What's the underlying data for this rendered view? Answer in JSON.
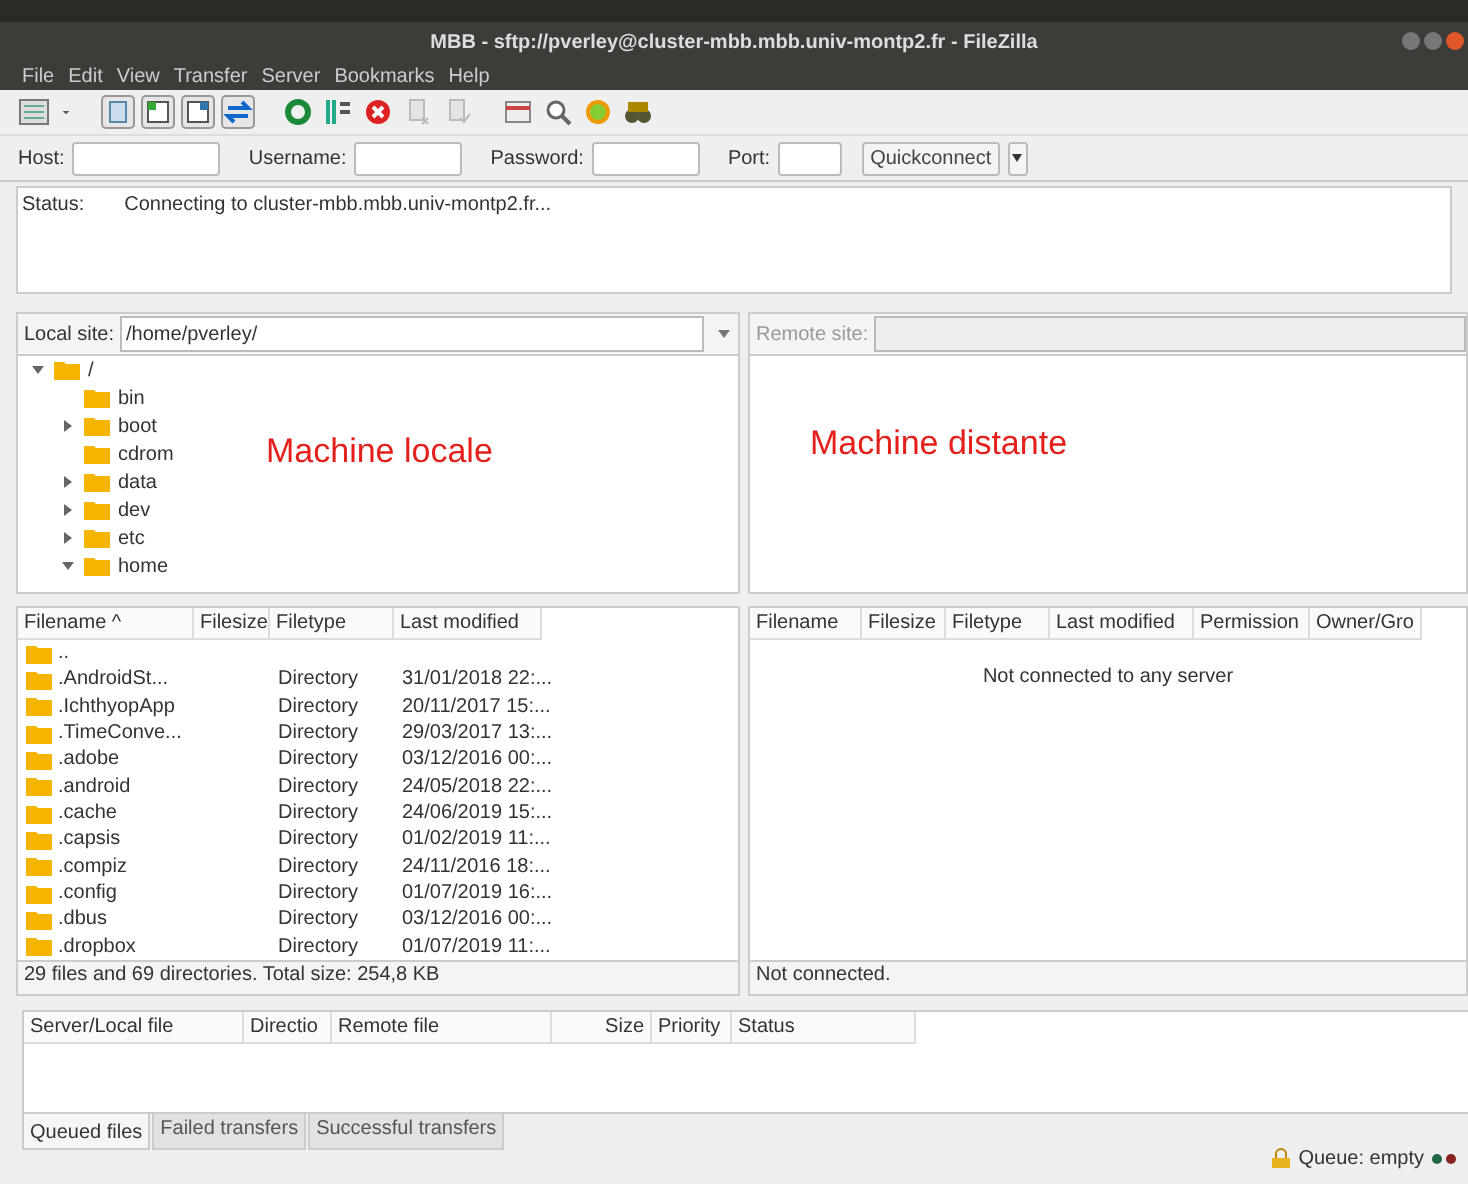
{
  "window": {
    "title": "MBB - sftp://pverley@cluster-mbb.mbb.univ-montp2.fr - FileZilla"
  },
  "menu": [
    "File",
    "Edit",
    "View",
    "Transfer",
    "Server",
    "Bookmarks",
    "Help"
  ],
  "quickconnect": {
    "fields": [
      {
        "label": "Host:"
      },
      {
        "label": "Username:"
      },
      {
        "label": "Password:"
      },
      {
        "label": "Port:"
      }
    ],
    "button": "Quickconnect"
  },
  "log": [
    {
      "label": "Status:",
      "text": "Connecting to cluster-mbb.mbb.univ-montp2.fr..."
    }
  ],
  "local": {
    "site_label": "Local site:",
    "path": "/home/pverley/",
    "annotation": "Machine locale",
    "tree": [
      {
        "name": "/",
        "expanded": true,
        "children": [
          {
            "name": "bin"
          },
          {
            "name": "boot",
            "expanded": false
          },
          {
            "name": "cdrom"
          },
          {
            "name": "data",
            "expanded": false
          },
          {
            "name": "dev",
            "expanded": false
          },
          {
            "name": "etc",
            "expanded": false
          },
          {
            "name": "home",
            "expanded": true
          }
        ]
      }
    ],
    "columns": [
      "Filename ^",
      "Filesize",
      "Filetype",
      "Last modified"
    ],
    "rows": [
      {
        "name": "..",
        "type": "",
        "modified": ""
      },
      {
        "name": ".AndroidSt...",
        "type": "Directory",
        "modified": "31/01/2018 22:..."
      },
      {
        "name": ".IchthyopApp",
        "type": "Directory",
        "modified": "20/11/2017 15:..."
      },
      {
        "name": ".TimeConve...",
        "type": "Directory",
        "modified": "29/03/2017 13:..."
      },
      {
        "name": ".adobe",
        "type": "Directory",
        "modified": "03/12/2016 00:..."
      },
      {
        "name": ".android",
        "type": "Directory",
        "modified": "24/05/2018 22:..."
      },
      {
        "name": ".cache",
        "type": "Directory",
        "modified": "24/06/2019 15:..."
      },
      {
        "name": ".capsis",
        "type": "Directory",
        "modified": "01/02/2019 11:..."
      },
      {
        "name": ".compiz",
        "type": "Directory",
        "modified": "24/11/2016 18:..."
      },
      {
        "name": ".config",
        "type": "Directory",
        "modified": "01/07/2019 16:..."
      },
      {
        "name": ".dbus",
        "type": "Directory",
        "modified": "03/12/2016 00:..."
      },
      {
        "name": ".dropbox",
        "type": "Directory",
        "modified": "01/07/2019 11:..."
      }
    ],
    "status": "29 files and 69 directories. Total size: 254,8 KB"
  },
  "remote": {
    "site_label": "Remote site:",
    "annotation": "Machine distante",
    "columns": [
      "Filename",
      "Filesize",
      "Filetype",
      "Last modified",
      "Permission",
      "Owner/Gro"
    ],
    "message": "Not connected to any server",
    "status": "Not connected."
  },
  "queue": {
    "columns": [
      "Server/Local file",
      "Directio",
      "Remote file",
      "Size",
      "Priority",
      "Status"
    ],
    "tabs": [
      {
        "label": "Queued files",
        "selected": true
      },
      {
        "label": "Failed transfers",
        "selected": false
      },
      {
        "label": "Successful transfers",
        "selected": false
      }
    ]
  },
  "status_bar": {
    "queue": "Queue: empty"
  }
}
